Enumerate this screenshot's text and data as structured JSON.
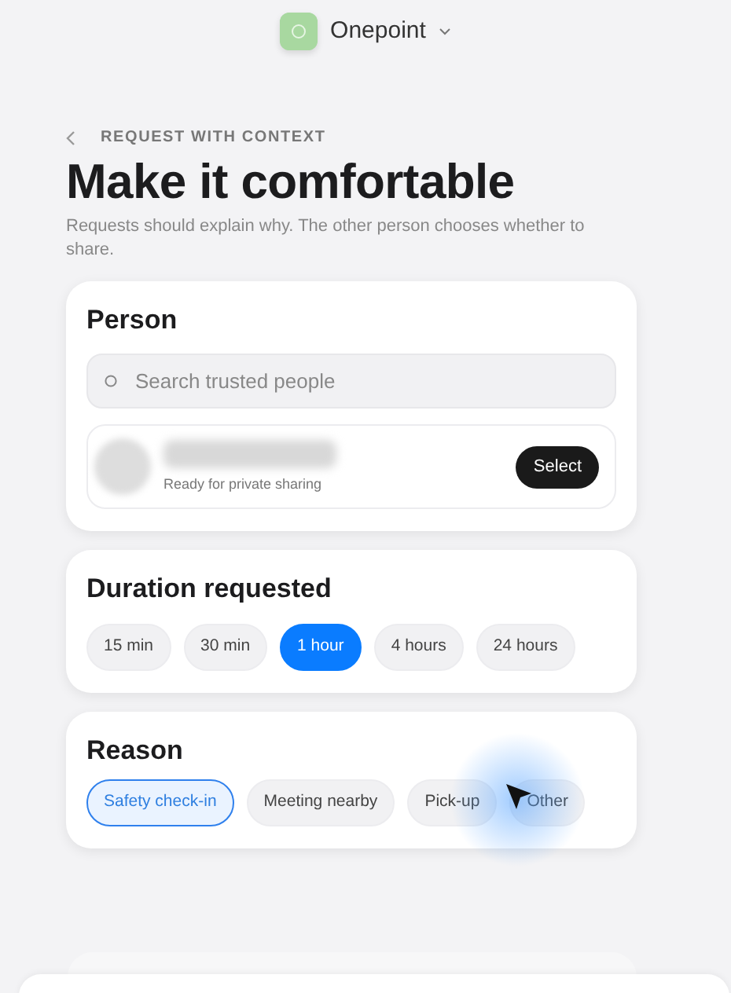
{
  "app": {
    "name": "Onepoint"
  },
  "header": {
    "eyebrow": "REQUEST WITH CONTEXT",
    "title": "Make it comfortable",
    "subtitle": "Requests should explain why. The other person chooses whether to share."
  },
  "person": {
    "title": "Person",
    "search": {
      "placeholder": "Search trusted people"
    },
    "candidates": [
      {
        "status": "Ready for private sharing",
        "action": "Select"
      }
    ]
  },
  "duration": {
    "title": "Duration requested",
    "options": [
      {
        "label": "15 min",
        "selected": false
      },
      {
        "label": "30 min",
        "selected": false
      },
      {
        "label": "1 hour",
        "selected": true
      },
      {
        "label": "4 hours",
        "selected": false
      },
      {
        "label": "24 hours",
        "selected": false
      }
    ]
  },
  "reason": {
    "title": "Reason",
    "options": [
      {
        "label": "Safety check-in",
        "selected": true
      },
      {
        "label": "Meeting nearby",
        "selected": false
      },
      {
        "label": "Pick-up",
        "selected": false
      },
      {
        "label": "Other",
        "selected": false
      }
    ]
  }
}
